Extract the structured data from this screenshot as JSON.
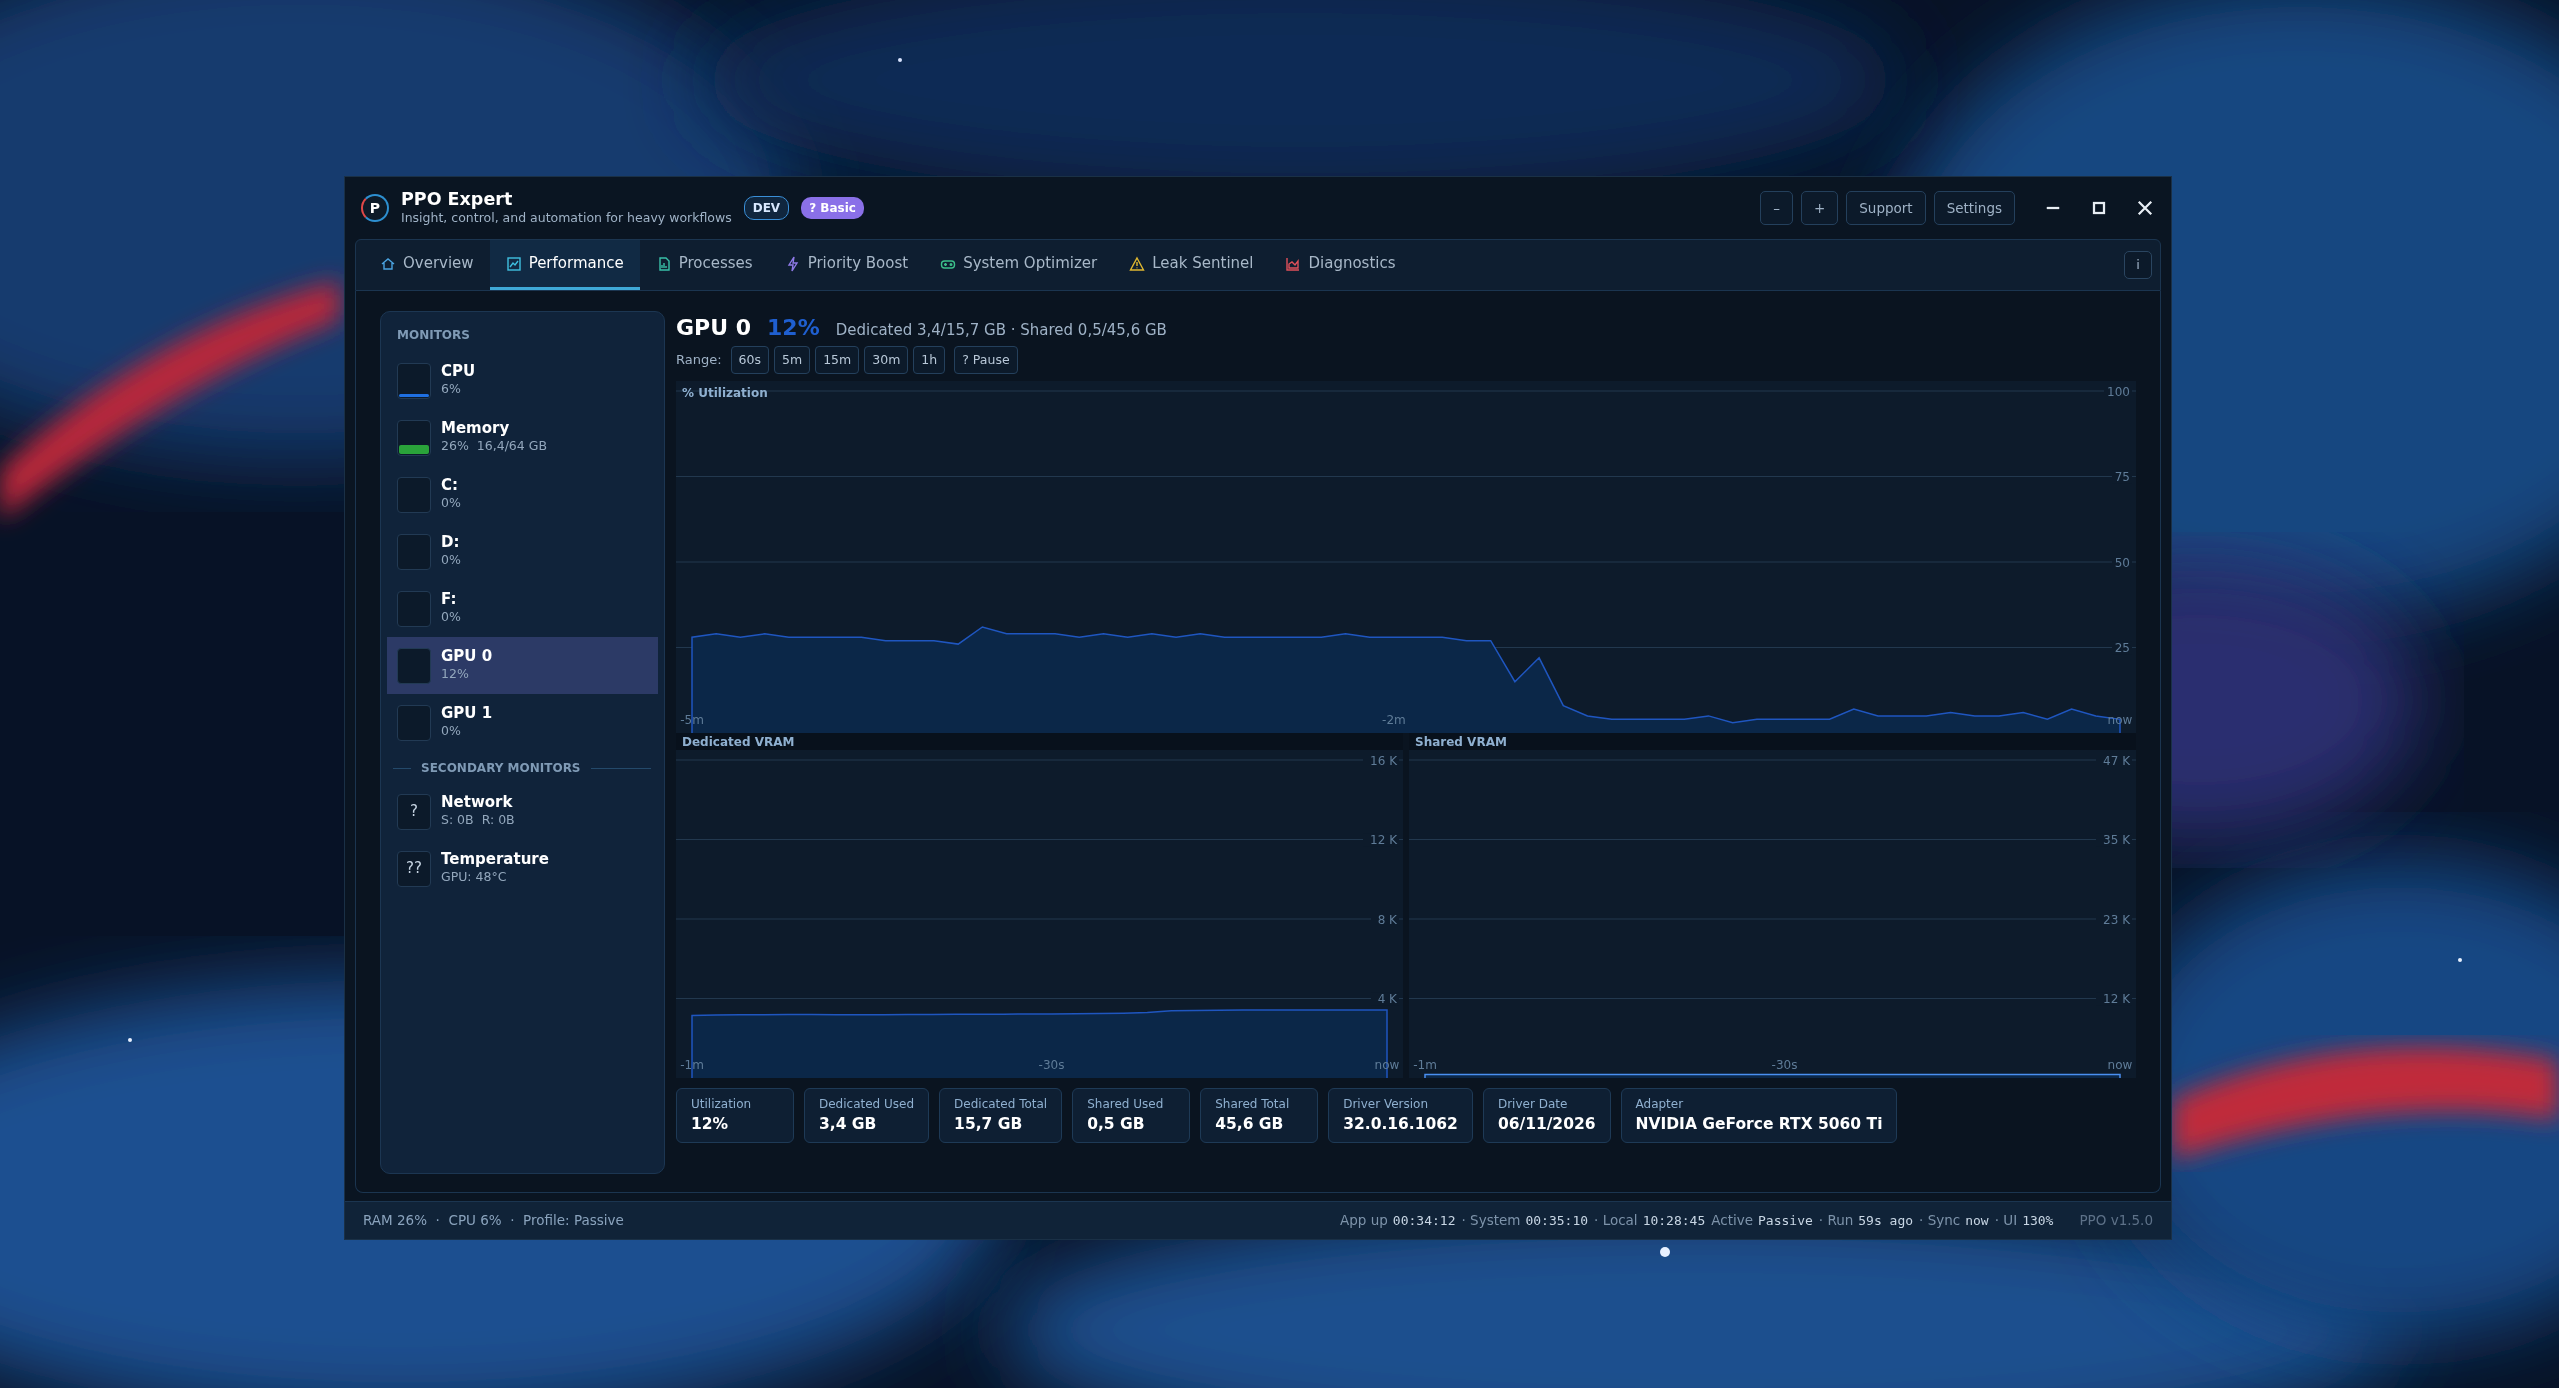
{
  "window": {
    "logo": "P",
    "title": "PPO Expert",
    "subtitle": "Insight, control, and automation for heavy workflows",
    "badges": [
      {
        "label": "DEV",
        "kind": "outline"
      },
      {
        "label": "? Basic",
        "kind": "filled"
      }
    ],
    "buttons": [
      "–",
      "+",
      "Support",
      "Settings"
    ]
  },
  "tabs": [
    {
      "label": "Overview",
      "selected": false
    },
    {
      "label": "Performance",
      "selected": true
    },
    {
      "label": "Processes",
      "selected": false
    },
    {
      "label": "Priority Boost",
      "selected": false
    },
    {
      "label": "System Optimizer",
      "selected": false
    },
    {
      "label": "Leak Sentinel",
      "selected": false
    },
    {
      "label": "Diagnostics",
      "selected": false
    }
  ],
  "info_button": "i",
  "sidebar": {
    "sections": [
      {
        "heading": "MONITORS",
        "items": [
          {
            "name": "CPU",
            "details": [
              "6%"
            ],
            "kind": "graph",
            "level": 0.06,
            "color": "#1f6fe0",
            "selected": false
          },
          {
            "name": "Memory",
            "details": [
              "26%",
              "16,4/64 GB"
            ],
            "kind": "graph",
            "level": 0.26,
            "color": "#2aa33a",
            "selected": false
          },
          {
            "name": "C:",
            "details": [
              "0%"
            ],
            "kind": "graph",
            "selected": false
          },
          {
            "name": "D:",
            "details": [
              "0%"
            ],
            "kind": "graph",
            "selected": false
          },
          {
            "name": "F:",
            "details": [
              "0%"
            ],
            "kind": "graph",
            "selected": false
          },
          {
            "name": "GPU 0",
            "details": [
              "12%"
            ],
            "kind": "graph",
            "selected": true
          },
          {
            "name": "GPU 1",
            "details": [
              "0%"
            ],
            "kind": "graph",
            "selected": false
          }
        ]
      },
      {
        "heading": "SECONDARY MONITORS",
        "items": [
          {
            "name": "Network",
            "details": [
              "S: 0B",
              "R: 0B"
            ],
            "kind": "glyph",
            "glyph": "?",
            "selected": false
          },
          {
            "name": "Temperature",
            "details": [
              "GPU: 48°C"
            ],
            "kind": "glyph",
            "glyph": "??",
            "selected": false
          }
        ]
      }
    ]
  },
  "main": {
    "title": "GPU 0",
    "percent": "12%",
    "summary": "Dedicated 3,4/15,7 GB · Shared 0,5/45,6 GB",
    "range_label": "Range:",
    "range_buttons": [
      "60s",
      "5m",
      "15m",
      "30m",
      "1h"
    ],
    "pause_button": "? Pause",
    "utilization": {
      "chart_data": {
        "type": "area",
        "title": "% Utilization",
        "ylim": [
          0,
          100
        ],
        "grid": true,
        "yticks": [
          25,
          50,
          75,
          100
        ],
        "categories": [
          "-5m",
          null,
          null,
          null,
          null,
          null,
          null,
          null,
          null,
          null,
          null,
          null,
          null,
          null,
          null,
          null,
          null,
          null,
          null,
          null,
          null,
          null,
          null,
          null,
          null,
          null,
          null,
          null,
          null,
          "-2m",
          null,
          null,
          null,
          null,
          null,
          null,
          null,
          null,
          null,
          null,
          null,
          null,
          null,
          null,
          null,
          null,
          null,
          null,
          null,
          null,
          null,
          null,
          null,
          null,
          null,
          null,
          null,
          null,
          null,
          "now"
        ],
        "values": [
          28,
          29,
          28,
          29,
          28,
          28,
          28,
          28,
          27,
          27,
          27,
          26,
          31,
          29,
          29,
          29,
          28,
          29,
          28,
          29,
          28,
          29,
          28,
          28,
          28,
          28,
          28,
          29,
          28,
          28,
          28,
          28,
          27,
          27,
          15,
          22,
          8,
          5,
          4,
          4,
          4,
          4,
          5,
          3,
          4,
          4,
          4,
          4,
          7,
          5,
          5,
          5,
          6,
          5,
          5,
          6,
          4,
          7,
          5,
          4
        ]
      }
    },
    "vram": [
      {
        "chart_data": {
          "type": "area",
          "title": "Dedicated VRAM",
          "ylim": [
            0,
            16000
          ],
          "yticks": [
            {
              "value": 4000,
              "label": "4 K"
            },
            {
              "value": 8000,
              "label": "8 K"
            },
            {
              "value": 12000,
              "label": "12 K"
            },
            {
              "value": 16000,
              "label": "16 K"
            }
          ],
          "grid": true,
          "categories": [
            "-1m",
            null,
            null,
            null,
            null,
            null,
            null,
            null,
            null,
            null,
            null,
            null,
            null,
            null,
            null,
            "-30s",
            null,
            null,
            null,
            null,
            null,
            null,
            null,
            null,
            null,
            null,
            null,
            null,
            null,
            "now"
          ],
          "values": [
            3150,
            3170,
            3180,
            3180,
            3190,
            3190,
            3180,
            3180,
            3180,
            3190,
            3200,
            3210,
            3210,
            3210,
            3220,
            3220,
            3230,
            3240,
            3260,
            3300,
            3380,
            3400,
            3410,
            3420,
            3420,
            3420,
            3420,
            3420,
            3420,
            3420
          ]
        }
      },
      {
        "chart_data": {
          "type": "area",
          "title": "Shared VRAM",
          "ylim": [
            0,
            47000
          ],
          "yticks": [
            {
              "value": 11750,
              "label": "12 K"
            },
            {
              "value": 23500,
              "label": "23 K"
            },
            {
              "value": 35250,
              "label": "35 K"
            },
            {
              "value": 47000,
              "label": "47 K"
            }
          ],
          "grid": true,
          "categories": [
            "-1m",
            null,
            null,
            null,
            null,
            null,
            null,
            null,
            null,
            null,
            null,
            null,
            null,
            null,
            null,
            "-30s",
            null,
            null,
            null,
            null,
            null,
            null,
            null,
            null,
            null,
            null,
            null,
            null,
            null,
            "now"
          ],
          "values": [
            500,
            500,
            500,
            500,
            500,
            500,
            500,
            500,
            500,
            500,
            500,
            500,
            500,
            500,
            500,
            500,
            500,
            500,
            500,
            500,
            500,
            500,
            500,
            500,
            500,
            500,
            500,
            500,
            500,
            500
          ]
        }
      }
    ],
    "stats": [
      {
        "label": "Utilization",
        "value": "12%"
      },
      {
        "label": "Dedicated Used",
        "value": "3,4 GB"
      },
      {
        "label": "Dedicated Total",
        "value": "15,7 GB"
      },
      {
        "label": "Shared Used",
        "value": "0,5 GB"
      },
      {
        "label": "Shared Total",
        "value": "45,6 GB"
      },
      {
        "label": "Driver Version",
        "value": "32.0.16.1062"
      },
      {
        "label": "Driver Date",
        "value": "06/11/2026"
      },
      {
        "label": "Adapter",
        "value": "NVIDIA GeForce RTX 5060 Ti"
      }
    ]
  },
  "status_bar": {
    "left": "RAM 26%  ·  CPU 6%  ·  Profile: Passive",
    "segments": [
      {
        "label": "App up",
        "value": "00:34:12"
      },
      {
        "label": "· System",
        "value": "00:35:10"
      },
      {
        "label": "· Local",
        "value": "10:28:45"
      },
      {
        "label": "Active",
        "value": "Passive"
      },
      {
        "label": "· Run",
        "value": "59s ago"
      },
      {
        "label": "· Sync",
        "value": "now"
      },
      {
        "label": "· UI",
        "value": "130%"
      }
    ],
    "version": "PPO v1.5.0"
  }
}
